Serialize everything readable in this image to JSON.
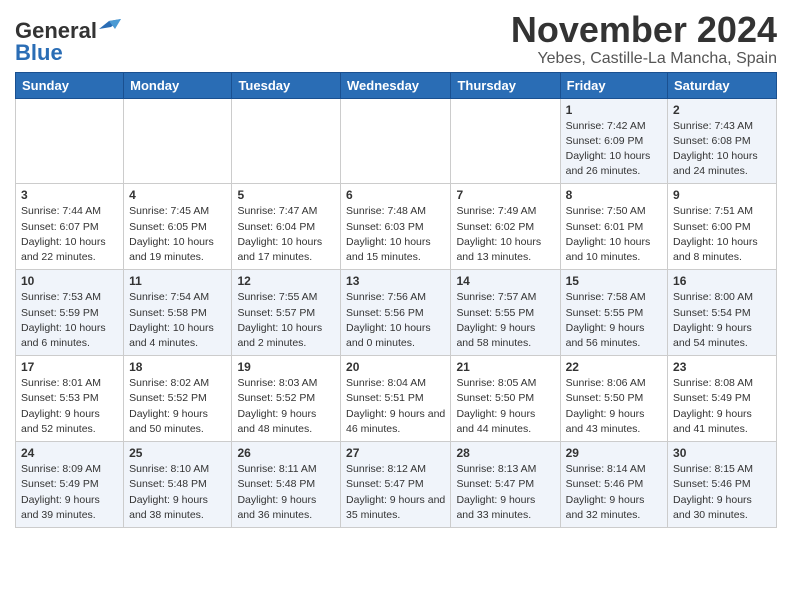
{
  "header": {
    "logo_line1": "General",
    "logo_line2": "Blue",
    "title": "November 2024",
    "subtitle": "Yebes, Castille-La Mancha, Spain"
  },
  "days_of_week": [
    "Sunday",
    "Monday",
    "Tuesday",
    "Wednesday",
    "Thursday",
    "Friday",
    "Saturday"
  ],
  "weeks": [
    [
      {
        "day": "",
        "info": ""
      },
      {
        "day": "",
        "info": ""
      },
      {
        "day": "",
        "info": ""
      },
      {
        "day": "",
        "info": ""
      },
      {
        "day": "",
        "info": ""
      },
      {
        "day": "1",
        "info": "Sunrise: 7:42 AM\nSunset: 6:09 PM\nDaylight: 10 hours and 26 minutes."
      },
      {
        "day": "2",
        "info": "Sunrise: 7:43 AM\nSunset: 6:08 PM\nDaylight: 10 hours and 24 minutes."
      }
    ],
    [
      {
        "day": "3",
        "info": "Sunrise: 7:44 AM\nSunset: 6:07 PM\nDaylight: 10 hours and 22 minutes."
      },
      {
        "day": "4",
        "info": "Sunrise: 7:45 AM\nSunset: 6:05 PM\nDaylight: 10 hours and 19 minutes."
      },
      {
        "day": "5",
        "info": "Sunrise: 7:47 AM\nSunset: 6:04 PM\nDaylight: 10 hours and 17 minutes."
      },
      {
        "day": "6",
        "info": "Sunrise: 7:48 AM\nSunset: 6:03 PM\nDaylight: 10 hours and 15 minutes."
      },
      {
        "day": "7",
        "info": "Sunrise: 7:49 AM\nSunset: 6:02 PM\nDaylight: 10 hours and 13 minutes."
      },
      {
        "day": "8",
        "info": "Sunrise: 7:50 AM\nSunset: 6:01 PM\nDaylight: 10 hours and 10 minutes."
      },
      {
        "day": "9",
        "info": "Sunrise: 7:51 AM\nSunset: 6:00 PM\nDaylight: 10 hours and 8 minutes."
      }
    ],
    [
      {
        "day": "10",
        "info": "Sunrise: 7:53 AM\nSunset: 5:59 PM\nDaylight: 10 hours and 6 minutes."
      },
      {
        "day": "11",
        "info": "Sunrise: 7:54 AM\nSunset: 5:58 PM\nDaylight: 10 hours and 4 minutes."
      },
      {
        "day": "12",
        "info": "Sunrise: 7:55 AM\nSunset: 5:57 PM\nDaylight: 10 hours and 2 minutes."
      },
      {
        "day": "13",
        "info": "Sunrise: 7:56 AM\nSunset: 5:56 PM\nDaylight: 10 hours and 0 minutes."
      },
      {
        "day": "14",
        "info": "Sunrise: 7:57 AM\nSunset: 5:55 PM\nDaylight: 9 hours and 58 minutes."
      },
      {
        "day": "15",
        "info": "Sunrise: 7:58 AM\nSunset: 5:55 PM\nDaylight: 9 hours and 56 minutes."
      },
      {
        "day": "16",
        "info": "Sunrise: 8:00 AM\nSunset: 5:54 PM\nDaylight: 9 hours and 54 minutes."
      }
    ],
    [
      {
        "day": "17",
        "info": "Sunrise: 8:01 AM\nSunset: 5:53 PM\nDaylight: 9 hours and 52 minutes."
      },
      {
        "day": "18",
        "info": "Sunrise: 8:02 AM\nSunset: 5:52 PM\nDaylight: 9 hours and 50 minutes."
      },
      {
        "day": "19",
        "info": "Sunrise: 8:03 AM\nSunset: 5:52 PM\nDaylight: 9 hours and 48 minutes."
      },
      {
        "day": "20",
        "info": "Sunrise: 8:04 AM\nSunset: 5:51 PM\nDaylight: 9 hours and 46 minutes."
      },
      {
        "day": "21",
        "info": "Sunrise: 8:05 AM\nSunset: 5:50 PM\nDaylight: 9 hours and 44 minutes."
      },
      {
        "day": "22",
        "info": "Sunrise: 8:06 AM\nSunset: 5:50 PM\nDaylight: 9 hours and 43 minutes."
      },
      {
        "day": "23",
        "info": "Sunrise: 8:08 AM\nSunset: 5:49 PM\nDaylight: 9 hours and 41 minutes."
      }
    ],
    [
      {
        "day": "24",
        "info": "Sunrise: 8:09 AM\nSunset: 5:49 PM\nDaylight: 9 hours and 39 minutes."
      },
      {
        "day": "25",
        "info": "Sunrise: 8:10 AM\nSunset: 5:48 PM\nDaylight: 9 hours and 38 minutes."
      },
      {
        "day": "26",
        "info": "Sunrise: 8:11 AM\nSunset: 5:48 PM\nDaylight: 9 hours and 36 minutes."
      },
      {
        "day": "27",
        "info": "Sunrise: 8:12 AM\nSunset: 5:47 PM\nDaylight: 9 hours and 35 minutes."
      },
      {
        "day": "28",
        "info": "Sunrise: 8:13 AM\nSunset: 5:47 PM\nDaylight: 9 hours and 33 minutes."
      },
      {
        "day": "29",
        "info": "Sunrise: 8:14 AM\nSunset: 5:46 PM\nDaylight: 9 hours and 32 minutes."
      },
      {
        "day": "30",
        "info": "Sunrise: 8:15 AM\nSunset: 5:46 PM\nDaylight: 9 hours and 30 minutes."
      }
    ]
  ]
}
